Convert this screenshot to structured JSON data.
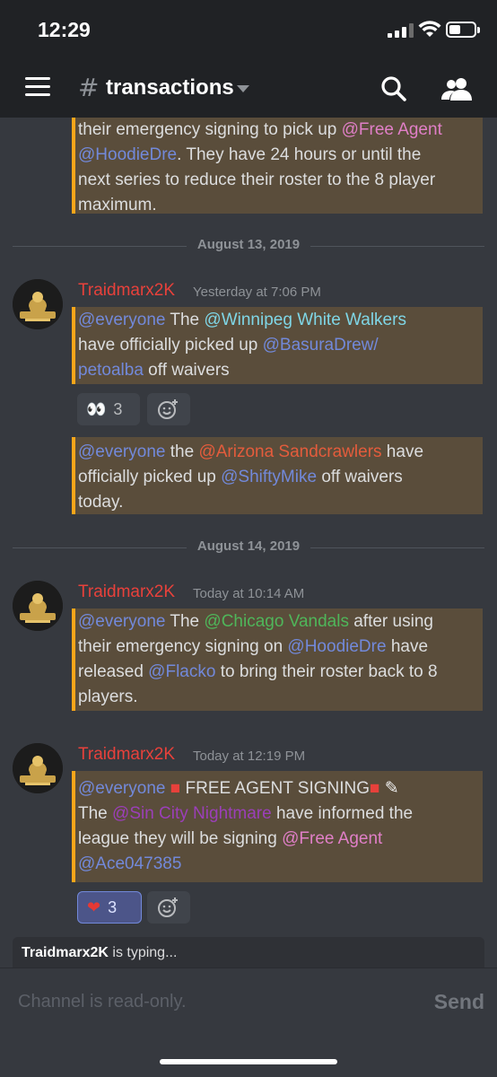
{
  "status_bar": {
    "time": "12:29"
  },
  "header": {
    "hash": "#",
    "channel": "transactions"
  },
  "messages": {
    "partial_top": {
      "line1_text": "their emergency signing to pick up ",
      "line1_mention": "@Free Agent",
      "line2_mention": "@HoodieDre",
      "line2_text": ". They have 24 hours or until the",
      "line3": "next series to reduce their roster to the 8 player",
      "line4": "maximum."
    },
    "divider1": "August 13, 2019",
    "group1": {
      "author": "Traidmarx2K",
      "timestamp": "Yesterday at 7:06 PM",
      "msg1": {
        "mention_everyone": "@everyone",
        "t1": " The ",
        "team": "@Winnipeg White Walkers",
        "t2": "have officially picked up ",
        "player_a": "@BasuraDrew/",
        "player_b": "petoalba",
        "t3": "  off waivers"
      },
      "reaction_count": "3",
      "msg2": {
        "mention_everyone": "@everyone",
        "t1": " the ",
        "team": "@Arizona Sandcrawlers",
        "t2": " have",
        "t3": "officially picked up ",
        "player": "@ShiftyMike",
        "t4": " off waivers",
        "t5": "today."
      }
    },
    "divider2": "August 14, 2019",
    "group2": {
      "author": "Traidmarx2K",
      "timestamp": "Today at 10:14 AM",
      "mention_everyone": "@everyone",
      "t1": " The ",
      "team": "@Chicago Vandals",
      "t2": " after using",
      "t3": "their emergency signing on ",
      "player": "@HoodieDre",
      "t4": " have",
      "t5": "released ",
      "player2": "@Flacko",
      "t6": " to bring their roster back to 8",
      "t7": "players."
    },
    "group3": {
      "author": "Traidmarx2K",
      "timestamp": "Today at 12:19 PM",
      "mention_everyone": "@everyone",
      "headline": "FREE AGENT SIGNING",
      "t1": "The ",
      "team": "@Sin City Nightmare",
      "t2": " have informed the",
      "t3": "league they will be signing ",
      "player": "@Free Agent",
      "player2": "@Ace047385",
      "reaction_count": "3"
    }
  },
  "typing": {
    "user": "Traidmarx2K",
    "text": " is typing..."
  },
  "input": {
    "placeholder": "Channel is read-only.",
    "send_label": "Send"
  },
  "colors": {
    "accent": "#faa61a",
    "author": "#e8413b",
    "mention": "#7289da"
  }
}
